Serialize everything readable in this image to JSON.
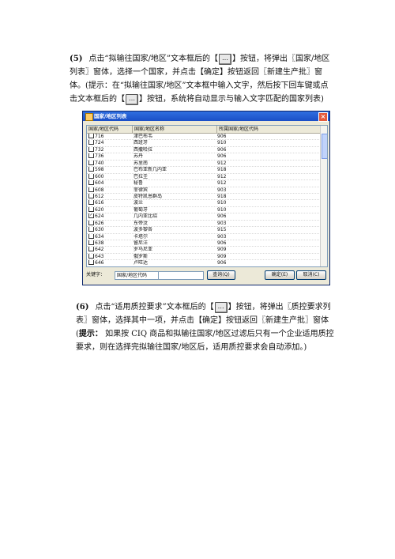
{
  "para5": {
    "num": "(5)",
    "t1": "点击“拟输往国家/地区”文本框后的【",
    "t2": "】按钮，将弹出〖国家/地区列表〗窗体，选择一个国家，并点击【确定】按钮返回〖新建生产批〗窗体。(提示：在“拟输往国家/地区”文本框中输入文字，然后按下回车键或点击文本框后的【",
    "t3": "】按钮，系统将自动显示与输入文字匹配的国家列表)"
  },
  "icon_glyph": "…",
  "dialog": {
    "title": "国家/地区列表",
    "close": "×",
    "headers": [
      "国家/地区代码",
      "国家/地区名称",
      "所属国家/地区代码"
    ],
    "rows": [
      {
        "code": "716",
        "name": "津巴布韦",
        "parent": "906",
        "checked": false
      },
      {
        "code": "724",
        "name": "西班牙",
        "parent": "910",
        "checked": false
      },
      {
        "code": "732",
        "name": "西撒哈拉",
        "parent": "906",
        "checked": false
      },
      {
        "code": "736",
        "name": "苏丹",
        "parent": "906",
        "checked": false
      },
      {
        "code": "740",
        "name": "苏里南",
        "parent": "912",
        "checked": false
      },
      {
        "code": "598",
        "name": "巴布亚新几内亚",
        "parent": "918",
        "checked": false
      },
      {
        "code": "600",
        "name": "巴拉圭",
        "parent": "912",
        "checked": false
      },
      {
        "code": "604",
        "name": "秘鲁",
        "parent": "912",
        "checked": false
      },
      {
        "code": "608",
        "name": "菲律宾",
        "parent": "903",
        "checked": false
      },
      {
        "code": "612",
        "name": "皮特凯恩群岛",
        "parent": "918",
        "checked": false
      },
      {
        "code": "616",
        "name": "波兰",
        "parent": "910",
        "checked": false
      },
      {
        "code": "620",
        "name": "葡萄牙",
        "parent": "910",
        "checked": false
      },
      {
        "code": "624",
        "name": "几内亚比绍",
        "parent": "906",
        "checked": true
      },
      {
        "code": "626",
        "name": "东帝汶",
        "parent": "903",
        "checked": false
      },
      {
        "code": "630",
        "name": "波多黎各",
        "parent": "915",
        "checked": false
      },
      {
        "code": "634",
        "name": "卡塔尔",
        "parent": "903",
        "checked": false
      },
      {
        "code": "638",
        "name": "留尼汪",
        "parent": "906",
        "checked": false
      },
      {
        "code": "642",
        "name": "罗马尼亚",
        "parent": "909",
        "checked": false
      },
      {
        "code": "643",
        "name": "俄罗斯",
        "parent": "909",
        "checked": false
      },
      {
        "code": "646",
        "name": "卢旺达",
        "parent": "906",
        "checked": false
      }
    ],
    "keyword_label": "关键字：",
    "field_select": "国家/地区代码",
    "search_btn": "查询(Q)",
    "ok_btn": "确定(E)",
    "cancel_btn": "取消(C)"
  },
  "para6": {
    "num": "(6)",
    "t1": "点击“适用质控要求”文本框后的【",
    "t2": "】按钮，将弹出〖质控要求列表〗窗体，选择其中一项，并点击【确定】按钮返回〖新建生产批〗窗体(",
    "tip": "提示：",
    "t3": " 如果按 CIQ 商品和拟输往国家/地区过滤后只有一个企业适用质控要求，则在选择完拟输往国家/地区后，适用质控要求会自动添加。)"
  }
}
